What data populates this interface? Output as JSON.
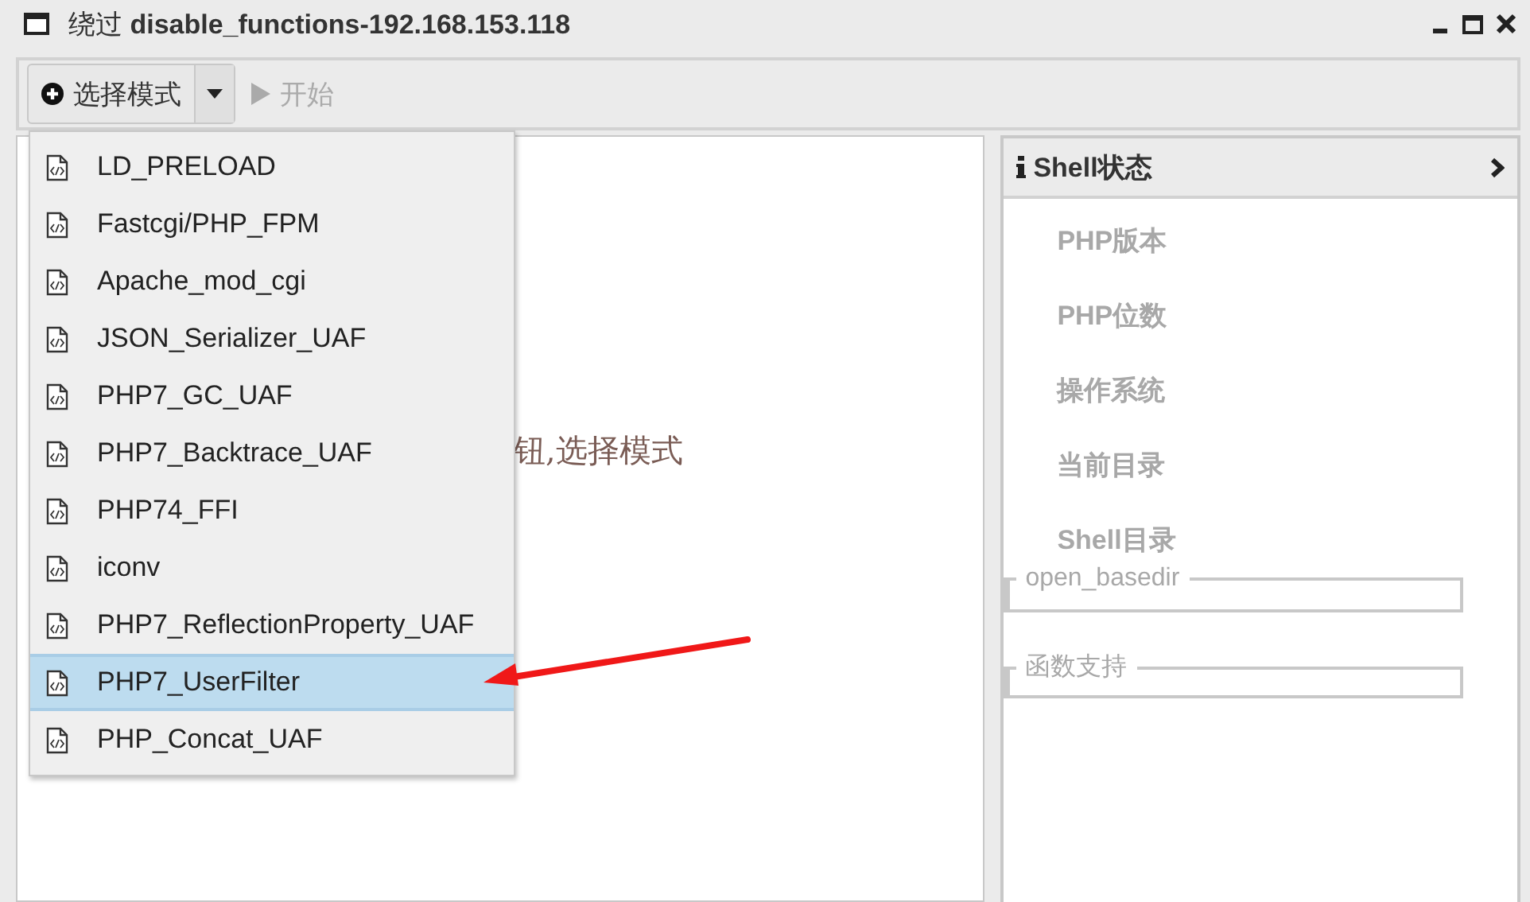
{
  "window": {
    "title_prefix": "绕过",
    "title": "disable_functions-192.168.153.118"
  },
  "toolbar": {
    "mode_button": "选择模式",
    "start_button": {
      "label": "开始",
      "disabled": true
    }
  },
  "main": {
    "hint": "钮,选择模式"
  },
  "mode_menu": {
    "items": [
      {
        "label": "LD_PRELOAD",
        "selected": false
      },
      {
        "label": "Fastcgi/PHP_FPM",
        "selected": false
      },
      {
        "label": "Apache_mod_cgi",
        "selected": false
      },
      {
        "label": "JSON_Serializer_UAF",
        "selected": false
      },
      {
        "label": "PHP7_GC_UAF",
        "selected": false
      },
      {
        "label": "PHP7_Backtrace_UAF",
        "selected": false
      },
      {
        "label": "PHP74_FFI",
        "selected": false
      },
      {
        "label": "iconv",
        "selected": false
      },
      {
        "label": "PHP7_ReflectionProperty_UAF",
        "selected": false
      },
      {
        "label": "PHP7_UserFilter",
        "selected": true
      },
      {
        "label": "PHP_Concat_UAF",
        "selected": false
      }
    ]
  },
  "shell_panel": {
    "title": "Shell状态",
    "fields": [
      "PHP版本",
      "PHP位数",
      "操作系统",
      "当前目录",
      "Shell目录"
    ],
    "groups": [
      {
        "legend": "open_basedir"
      },
      {
        "legend": "函数支持"
      }
    ]
  }
}
